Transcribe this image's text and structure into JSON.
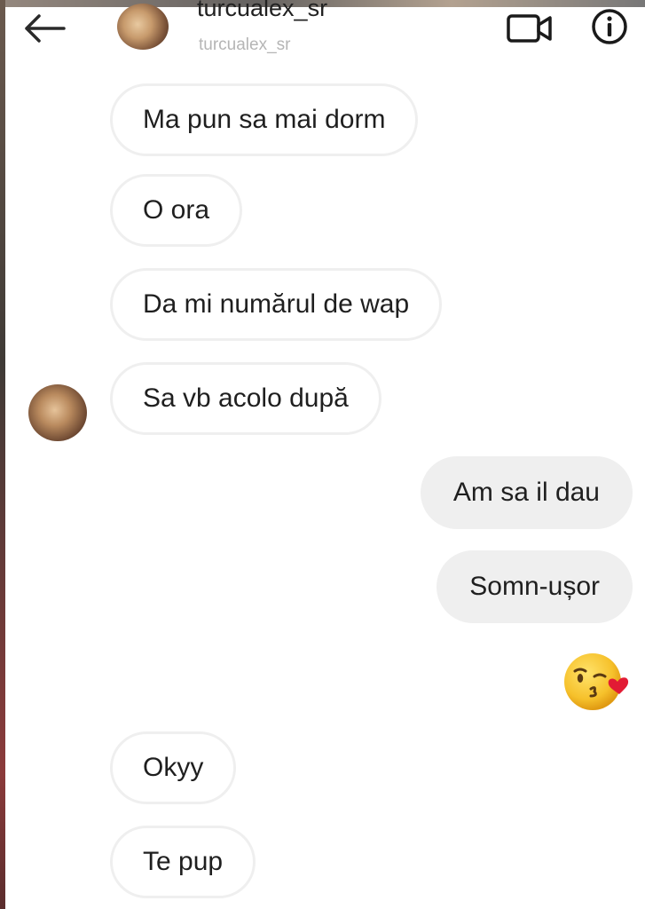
{
  "header": {
    "username": "turcualex_sr",
    "subtitle": "turcualex_sr"
  },
  "messages": [
    {
      "side": "in",
      "text": "Ma pun sa mai dorm"
    },
    {
      "side": "in",
      "text": "O ora"
    },
    {
      "side": "in",
      "text": "Da mi numărul de wap"
    },
    {
      "side": "in",
      "text": "Sa vb acolo după"
    },
    {
      "side": "out",
      "text": "Am sa il dau"
    },
    {
      "side": "out",
      "text": "Somn-ușor"
    },
    {
      "side": "out",
      "emoji": "face-blowing-a-kiss"
    },
    {
      "side": "in",
      "text": "Okyy"
    },
    {
      "side": "in",
      "text": "Te pup"
    }
  ],
  "icons": {
    "back": "arrow-left-icon",
    "video": "video-camera-icon",
    "info": "info-icon"
  },
  "colors": {
    "incoming_bubble": "#ffffff",
    "incoming_border": "#efefef",
    "outgoing_bubble": "#efefef",
    "text": "#1f1f1f",
    "subtitle": "#b5b5b5"
  }
}
